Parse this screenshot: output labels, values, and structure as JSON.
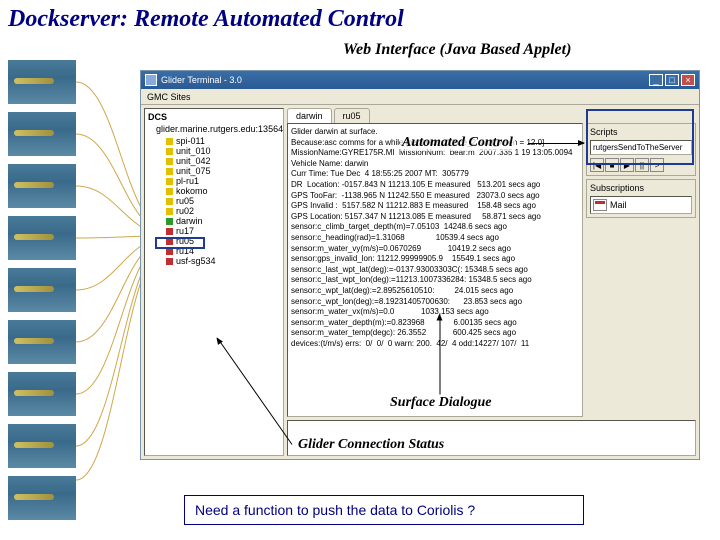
{
  "slide": {
    "title": "Dockserver: Remote Automated Control",
    "subtitle": "Web Interface (Java Based Applet)"
  },
  "window": {
    "title": "Glider Terminal - 3.0",
    "menu": [
      "GMC Sites"
    ]
  },
  "tree": {
    "root": "DCS",
    "server": "glider.marine.rutgers.edu:13564",
    "items": [
      {
        "color": "yellow",
        "label": "spi-011"
      },
      {
        "color": "yellow",
        "label": "unit_010"
      },
      {
        "color": "yellow",
        "label": "unit_042"
      },
      {
        "color": "yellow",
        "label": "unit_075"
      },
      {
        "color": "yellow",
        "label": "pl-ru1"
      },
      {
        "color": "yellow",
        "label": "kokomo"
      },
      {
        "color": "yellow",
        "label": "ru05"
      },
      {
        "color": "yellow",
        "label": "ru02"
      },
      {
        "color": "green",
        "label": "darwin"
      },
      {
        "color": "red",
        "label": "ru17"
      },
      {
        "color": "red",
        "label": "ru05"
      },
      {
        "color": "red",
        "label": "ru14"
      },
      {
        "color": "red",
        "label": "usf-sg534"
      }
    ]
  },
  "tabs": [
    {
      "label": "darwin",
      "active": true
    },
    {
      "label": "ru05",
      "active": false
    }
  ],
  "log": {
    "line1": "Glider darwin at surface.",
    "line2": "Because:asc comms for a while [behavior surface_2 start_when = 12.0]",
    "line3": "MissionName:GYRE175R.MI  MissionNum:  bear:m  2007.335 1 19 13:05.0094",
    "line4": "Vehicle Name: darwin",
    "line5": "Curr Time: Tue Dec  4 18:55:25 2007 MT:  305779",
    "line6": "DR  Location: -0157.843 N 11213.105 E measured   513.201 secs ago",
    "line7": "GPS TooFar:  -1138.965 N 11242.550 E measured   23073.0 secs ago",
    "line8": "GPS Invalid :  5157.582 N 11212.883 E measured    158.48 secs ago",
    "line9": "GPS Location: 5157.347 N 11213.085 E measured     58.871 secs ago",
    "line10": "sensor:c_climb_target_depth(m)=7.05103  14248.6 secs ago",
    "line11": "sensor:c_heading(rad)=1.31068              10539.4 secs ago",
    "line12": "sensor:m_water_vy(m/s)=0.0670269            10419.2 secs ago",
    "line13": "sensor:gps_invalid_lon: 11212.99999905.9    15549.1 secs ago",
    "line14": "sensor:c_last_wpt_lat(deg):=-0137.93003303C(: 15348.5 secs ago",
    "line15": "sensor:c_last_wpt_lon(deg):=11213.1007336284: 15348.5 secs ago",
    "line16": "sensor:c_wpt_lat(deg):=2.89525610510:         24.015 secs ago",
    "line17": "sensor:c_wpt_lon(deg):=8.19231405700630:      23.853 secs ago",
    "line18": "sensor:m_water_vx(m/s)=0.0            1033.153 secs ago",
    "line19": "sensor:m_water_depth(m):=0.823968             6.00135 secs ago",
    "line20": "sensor:m_water_temp(degc): 26.3552            600.425 secs ago",
    "line21": "devices:(t/m/s) errs:  0/  0/  0 warn: 200.  42/  4 odd:14227/ 107/  11"
  },
  "scripts": {
    "title": "Scripts",
    "item": "rutgersSendToTheServer",
    "buttons": [
      "|◀",
      "■",
      "▶",
      "||",
      ">"
    ]
  },
  "subs": {
    "title": "Subscriptions",
    "item": "Mail"
  },
  "callouts": {
    "auto": "Automated Control",
    "surface": "Surface Dialogue",
    "status": "Glider Connection Status"
  },
  "footer": "Need a function to push the data to Coriolis ?"
}
